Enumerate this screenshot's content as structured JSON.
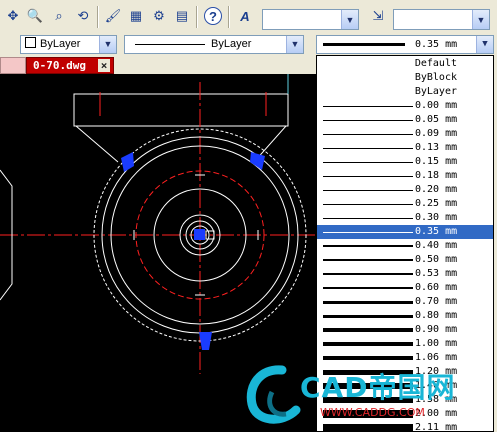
{
  "toolbar": {
    "icons": [
      "pan-realtime-icon",
      "zoom-realtime-icon",
      "zoom-window-icon",
      "zoom-previous-icon",
      "match-properties-icon",
      "design-center-icon",
      "tool-palettes-icon",
      "sheet-set-icon",
      "help-icon",
      "text-style-icon",
      "dim-style-icon"
    ],
    "text_style_value": "",
    "dim_style_value": ""
  },
  "properties": {
    "color_value": "ByLayer",
    "linetype_value": "ByLayer",
    "lineweight_value": "0.35 mm"
  },
  "tab": {
    "filename": "0-70.dwg",
    "close": "×"
  },
  "lineweight_list": {
    "items": [
      {
        "label": "Default",
        "weight": 0
      },
      {
        "label": "ByBlock",
        "weight": 0
      },
      {
        "label": "ByLayer",
        "weight": 0
      },
      {
        "label": "0.00 mm",
        "weight": 0.0
      },
      {
        "label": "0.05 mm",
        "weight": 0.05
      },
      {
        "label": "0.09 mm",
        "weight": 0.09
      },
      {
        "label": "0.13 mm",
        "weight": 0.13
      },
      {
        "label": "0.15 mm",
        "weight": 0.15
      },
      {
        "label": "0.18 mm",
        "weight": 0.18
      },
      {
        "label": "0.20 mm",
        "weight": 0.2
      },
      {
        "label": "0.25 mm",
        "weight": 0.25
      },
      {
        "label": "0.30 mm",
        "weight": 0.3
      },
      {
        "label": "0.35 mm",
        "weight": 0.35,
        "selected": true
      },
      {
        "label": "0.40 mm",
        "weight": 0.4
      },
      {
        "label": "0.50 mm",
        "weight": 0.5
      },
      {
        "label": "0.53 mm",
        "weight": 0.53
      },
      {
        "label": "0.60 mm",
        "weight": 0.6
      },
      {
        "label": "0.70 mm",
        "weight": 0.7
      },
      {
        "label": "0.80 mm",
        "weight": 0.8
      },
      {
        "label": "0.90 mm",
        "weight": 0.9
      },
      {
        "label": "1.00 mm",
        "weight": 1.0
      },
      {
        "label": "1.06 mm",
        "weight": 1.06
      },
      {
        "label": "1.20 mm",
        "weight": 1.2
      },
      {
        "label": "1.40 mm",
        "weight": 1.4
      },
      {
        "label": "1.58 mm",
        "weight": 1.58
      },
      {
        "label": "2.00 mm",
        "weight": 2.0
      },
      {
        "label": "2.11 mm",
        "weight": 2.11
      }
    ]
  },
  "watermark": {
    "brand": "CAD帝国网",
    "url": "WWW.CADDG.COM"
  },
  "colors": {
    "toolbar_bg": "#ece9d8",
    "canvas_bg": "#000000",
    "tab_active": "#c00000",
    "selection": "#316ac5",
    "centerline_red": "#ff2020",
    "grip_blue": "#1a3cff",
    "watermark_cyan": "#19b6d6",
    "watermark_red": "#e0262b"
  }
}
